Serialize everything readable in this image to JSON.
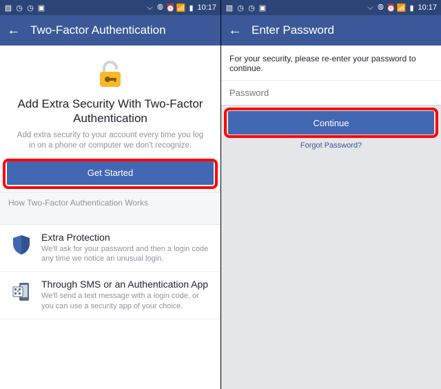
{
  "status": {
    "time": "10:17"
  },
  "left": {
    "appbar_title": "Two-Factor Authentication",
    "hero_title": "Add Extra Security With Two-Factor Authentication",
    "hero_desc": "Add extra security to your account every time you log in on a phone or computer we don't recognize.",
    "cta_label": "Get Started",
    "section_label": "How Two-Factor Authentication Works",
    "items": [
      {
        "title": "Extra Protection",
        "desc": "We'll ask for your password and then a login code any time we notice an unusual login."
      },
      {
        "title": "Through SMS or an Authentication App",
        "desc": "We'll send a text message with a login code, or you can use a security app of your choice."
      }
    ]
  },
  "right": {
    "appbar_title": "Enter Password",
    "message": "For your security, please re-enter your password to continue.",
    "placeholder": "Password",
    "cta_label": "Continue",
    "forgot_label": "Forgot Password?"
  }
}
